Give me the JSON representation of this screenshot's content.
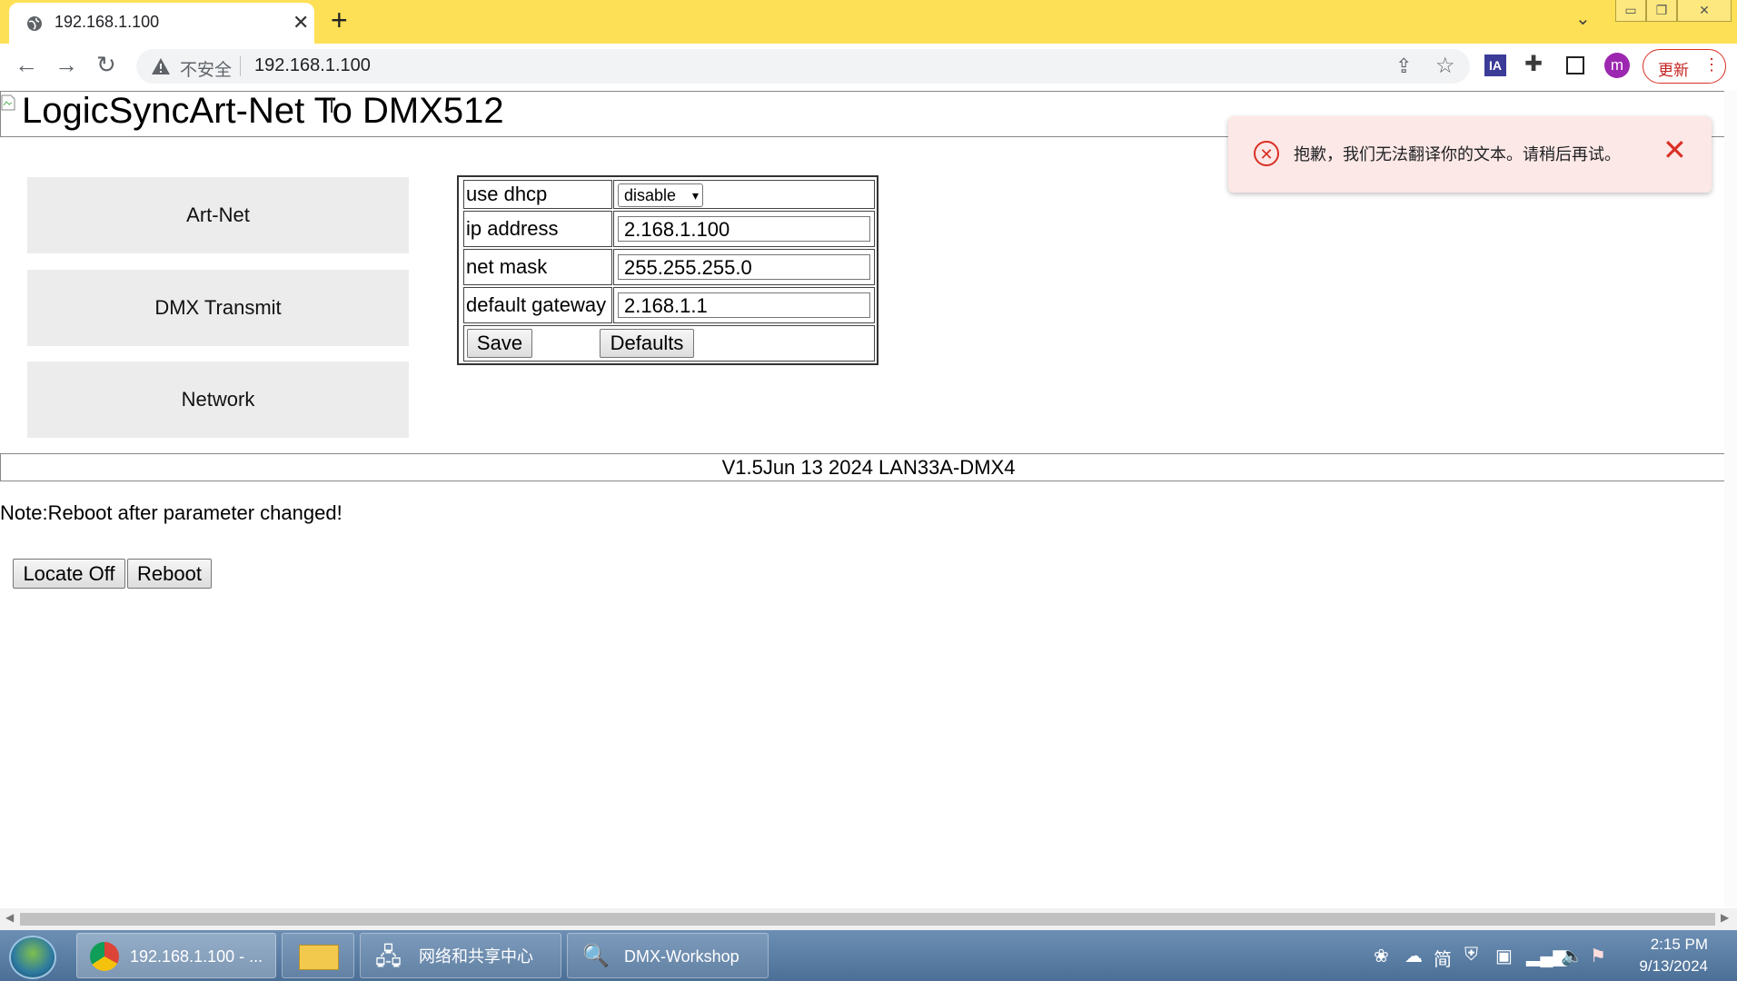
{
  "browser": {
    "tab_title": "192.168.1.100",
    "insecure_label": "不安全",
    "url": "192.168.1.100",
    "update_label": "更新",
    "profile_initial": "m",
    "ia_label": "IA"
  },
  "page": {
    "title": "LogicSyncArt-Net To DMX512",
    "nav": [
      "Art-Net",
      "DMX Transmit",
      "Network"
    ],
    "form": {
      "dhcp_label": "use dhcp",
      "dhcp_value": "disable",
      "ip_label": "ip address",
      "ip_value": "2.168.1.100",
      "mask_label": "net mask",
      "mask_value": "255.255.255.0",
      "gateway_label": "default gateway",
      "gateway_value": "2.168.1.1",
      "save_label": "Save",
      "defaults_label": "Defaults"
    },
    "version": "V1.5Jun 13 2024 LAN33A-DMX4",
    "note": "Note:Reboot after parameter changed!",
    "locate_label": "Locate Off",
    "reboot_label": "Reboot"
  },
  "toast": {
    "message": "抱歉，我们无法翻译你的文本。请稍后再试。",
    "icon": "error-circle-icon"
  },
  "taskbar": {
    "items": [
      "192.168.1.100 - ...",
      "网络和共享中心",
      "DMX-Workshop"
    ],
    "time": "2:15 PM",
    "date": "9/13/2024",
    "ime": "简"
  },
  "colors": {
    "tabstrip": "#fde055",
    "toast_bg": "#fce8e6",
    "toast_accent": "#d93025",
    "nav_bg": "#ececec"
  }
}
